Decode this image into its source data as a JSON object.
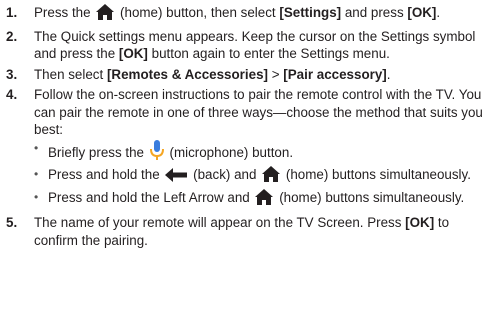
{
  "steps": [
    {
      "number": "1.",
      "before": "Press the",
      "home_icon": "home-icon",
      "after": "(home) button, then select",
      "settings": "[Settings]",
      "and_press": "and press",
      "ok": "[OK]",
      "end": "."
    },
    {
      "number": "2.",
      "text_a": "The Quick settings menu appears. Keep the cursor on the Settings symbol and press the",
      "ok": "[OK]",
      "text_b": "button again to enter the Settings menu."
    },
    {
      "number": "3.",
      "text_a": "Then select",
      "remotes": "[Remotes & Accessories]",
      "sep": ">",
      "pair": "[Pair accessory]",
      "end": "."
    },
    {
      "number": "4.",
      "text": "Follow the on-screen instructions to pair the remote control with the TV. You can pair the remote in one of three ways—choose the method that suits you best:",
      "options": [
        {
          "before": "Briefly press the",
          "icon": "microphone-icon",
          "after": "(microphone) button."
        },
        {
          "before": "Press and hold the",
          "icon": "back-arrow-icon",
          "middle": "(back) and",
          "icon2": "home-icon",
          "after": "(home) buttons simultaneously."
        },
        {
          "before": "Press and hold the Left Arrow and",
          "icon": "home-icon",
          "after": "(home) buttons simultaneously."
        }
      ]
    },
    {
      "number": "5.",
      "text_a": "The name of your remote will appear on the TV Screen. Press",
      "ok": "[OK]",
      "text_b": "to confirm the pairing."
    }
  ],
  "colors": {
    "text": "#231f20",
    "icon_dark": "#231f20",
    "mic_blue": "#3b7ddd",
    "mic_orange": "#f5a623"
  }
}
